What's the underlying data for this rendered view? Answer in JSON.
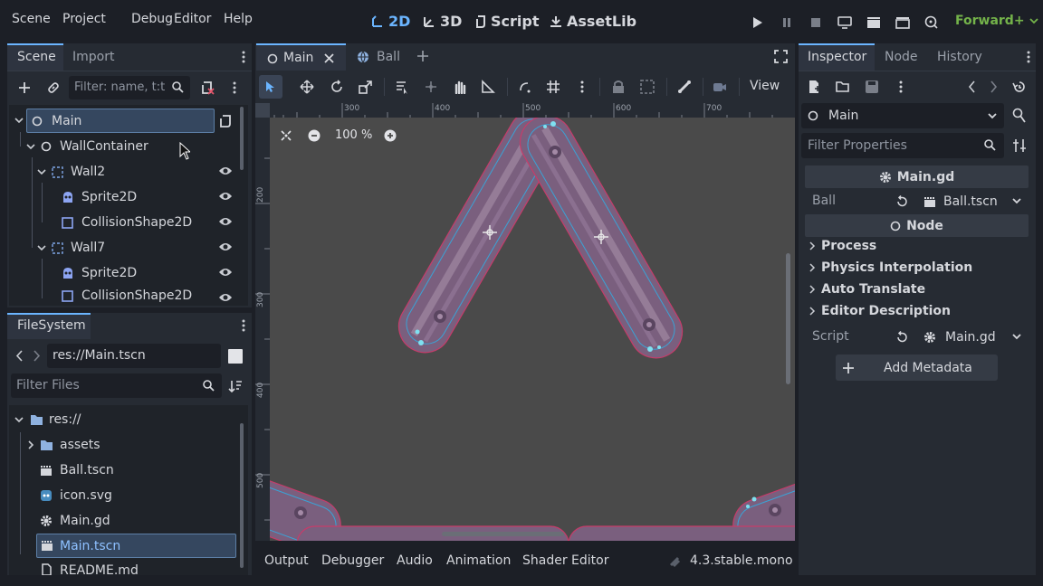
{
  "menu": {
    "items": [
      "Scene",
      "Project",
      "Debug",
      "Editor",
      "Help"
    ]
  },
  "workspaces": {
    "w2d": "2D",
    "w3d": "3D",
    "script": "Script",
    "assetlib": "AssetLib"
  },
  "renderer": "Forward+",
  "colors": {
    "accent": "#6bb5ff",
    "renderer": "#74b34a",
    "selection": "#35475f",
    "viewport": "#4a4a4a",
    "wall_body": "#7a5f7e",
    "wall_outline": "#c63c6a",
    "collision": "#3aa3d6"
  },
  "scene_dock": {
    "tabs": [
      "Scene",
      "Import"
    ],
    "filter_placeholder": "Filter: name, t:t",
    "tree": [
      {
        "label": "Main",
        "icon": "node-circle-icon",
        "selected": true
      },
      {
        "label": "WallContainer",
        "icon": "node-circle-icon"
      },
      {
        "label": "Wall2",
        "icon": "static-body-icon"
      },
      {
        "label": "Sprite2D",
        "icon": "sprite-icon"
      },
      {
        "label": "CollisionShape2D",
        "icon": "collision-shape-icon"
      },
      {
        "label": "Wall7",
        "icon": "static-body-icon"
      },
      {
        "label": "Sprite2D",
        "icon": "sprite-icon"
      },
      {
        "label": "CollisionShape2D",
        "icon": "collision-shape-icon"
      }
    ]
  },
  "filesystem": {
    "tab": "FileSystem",
    "path": "res://Main.tscn",
    "filter_placeholder": "Filter Files",
    "items": [
      {
        "label": "res://",
        "icon": "folder-icon"
      },
      {
        "label": "assets",
        "icon": "folder-icon"
      },
      {
        "label": "Ball.tscn",
        "icon": "scene-file-icon"
      },
      {
        "label": "icon.svg",
        "icon": "godot-icon"
      },
      {
        "label": "Main.gd",
        "icon": "gear-icon"
      },
      {
        "label": "Main.tscn",
        "icon": "scene-file-icon",
        "selected": true
      },
      {
        "label": "README.md",
        "icon": "doc-icon"
      }
    ]
  },
  "editor_tabs": [
    {
      "label": "Main",
      "active": true
    },
    {
      "label": "Ball"
    }
  ],
  "viewport": {
    "view_label": "View",
    "zoom": "100 %",
    "ruler_top": [
      "300",
      "400",
      "500",
      "600",
      "700"
    ],
    "ruler_left": [
      "200",
      "300",
      "400",
      "500"
    ]
  },
  "bottom_panel": {
    "tabs": [
      "Output",
      "Debugger",
      "Audio",
      "Animation",
      "Shader Editor"
    ],
    "version": "4.3.stable.mono"
  },
  "inspector": {
    "tabs": [
      "Inspector",
      "Node",
      "History"
    ],
    "object": "Main",
    "filter_placeholder": "Filter Properties",
    "script_section": "Main.gd",
    "ball_label": "Ball",
    "ball_value": "Ball.tscn",
    "node_section": "Node",
    "groups": [
      "Process",
      "Physics Interpolation",
      "Auto Translate",
      "Editor Description"
    ],
    "script_label": "Script",
    "script_value": "Main.gd",
    "add_metadata": "Add Metadata"
  }
}
